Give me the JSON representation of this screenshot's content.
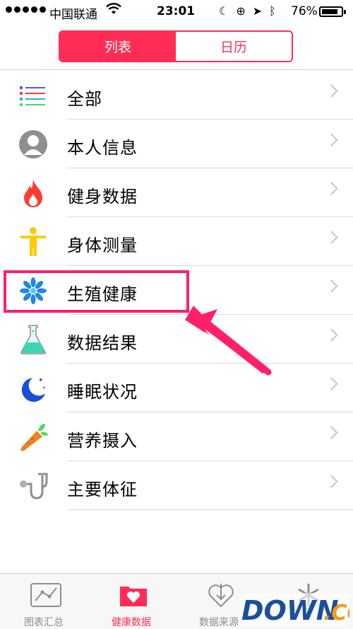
{
  "status_bar": {
    "carrier": "中国联通",
    "time": "23:01",
    "battery": "76%",
    "icons": [
      "wifi-icon",
      "moon-icon",
      "orientation-lock-icon",
      "location-icon",
      "bluetooth-icon",
      "battery-icon"
    ]
  },
  "segmented": {
    "left": "列表",
    "right": "日历",
    "active": "left"
  },
  "list": [
    {
      "label": "全部",
      "icon": "list-icon"
    },
    {
      "label": "本人信息",
      "icon": "person-icon"
    },
    {
      "label": "健身数据",
      "icon": "flame-icon"
    },
    {
      "label": "身体测量",
      "icon": "body-icon"
    },
    {
      "label": "生殖健康",
      "icon": "snowflake-icon"
    },
    {
      "label": "数据结果",
      "icon": "flask-icon"
    },
    {
      "label": "睡眠状况",
      "icon": "moon-stars-icon"
    },
    {
      "label": "营养摄入",
      "icon": "carrot-icon"
    },
    {
      "label": "主要体征",
      "icon": "stethoscope-icon"
    }
  ],
  "tabbar": [
    {
      "label": "图表汇总",
      "icon": "chart-icon"
    },
    {
      "label": "健康数据",
      "icon": "health-data-icon",
      "active": true
    },
    {
      "label": "数据来源",
      "icon": "download-heart-icon"
    },
    {
      "label": "",
      "icon": "medical-id-icon"
    }
  ],
  "colors": {
    "accent": "#ff2d55",
    "annotation": "#ff1f6a"
  },
  "watermark": "DOWN.CC"
}
